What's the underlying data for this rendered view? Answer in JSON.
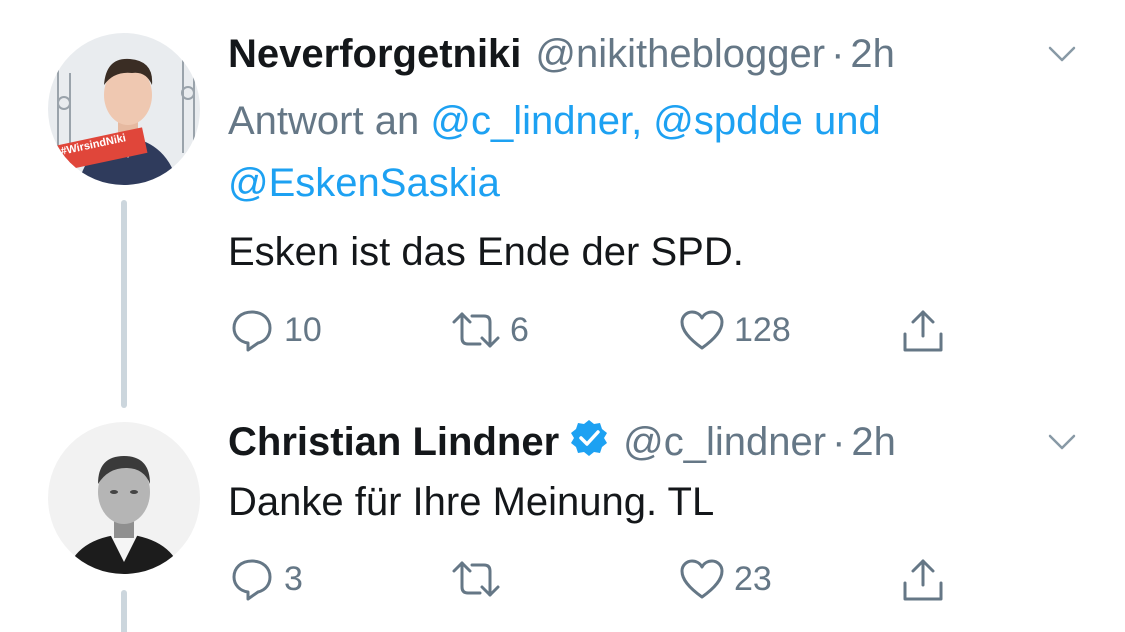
{
  "tweets": [
    {
      "display_name": "Neverforgetniki",
      "handle": "@nikitheblogger",
      "separator": "·",
      "time": "2h",
      "reply_prefix": "Antwort an",
      "reply_mentions": "@c_lindner, @spdde und @EskenSaskia",
      "avatar_badge": "#WirsindNiki",
      "text": "Esken ist das Ende der SPD.",
      "replies": "10",
      "retweets": "6",
      "likes": "128",
      "verified": false
    },
    {
      "display_name": "Christian Lindner",
      "handle": "@c_lindner",
      "separator": "·",
      "time": "2h",
      "text": "Danke für Ihre Meinung. TL",
      "replies": "3",
      "retweets": "",
      "likes": "23",
      "verified": true
    }
  ],
  "icons": {
    "reply": "speech-bubble-icon",
    "retweet": "retweet-arrows-icon",
    "like": "heart-icon",
    "share": "share-upload-icon",
    "caret": "chevron-down-icon",
    "verified": "verified-badge-icon"
  },
  "colors": {
    "text": "#14171a",
    "secondary": "#657786",
    "link": "#1da1f2",
    "thread_line": "#ccd6dd",
    "badge_red": "#e0463a"
  }
}
